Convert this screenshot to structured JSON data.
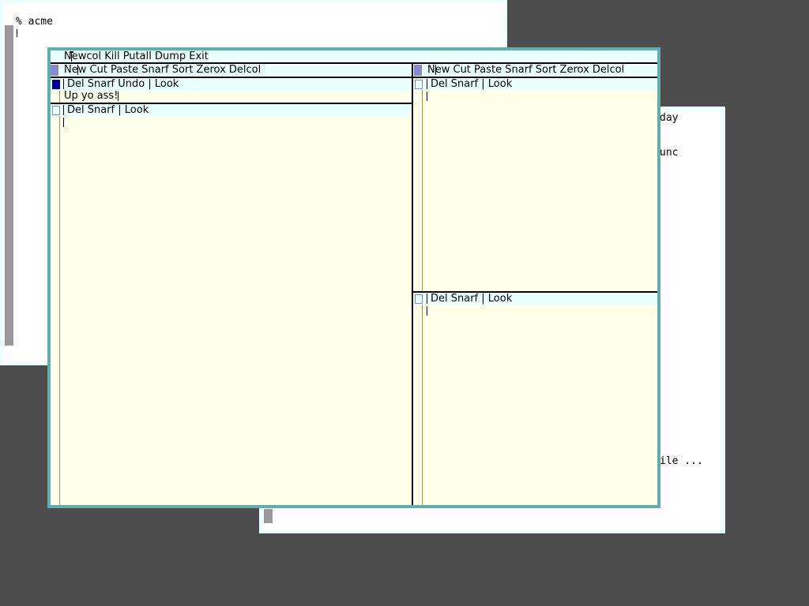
{
  "desktop": {
    "background": "#4d4d4d"
  },
  "rio_window_1": {
    "prompt_line": "% acme"
  },
  "rio_window_2": {
    "visible_fragments": [
      "day",
      "unc",
      "ile ..."
    ]
  },
  "acme": {
    "main_tag": "Newcol Kill Putall Dump Exit",
    "columns": [
      {
        "tag": "New Cut Paste Snarf Sort Zerox Delcol",
        "windows": [
          {
            "tag": "Del Snarf Undo | Look",
            "body": "Up yo ass!",
            "dirty": true
          },
          {
            "tag": "Del Snarf | Look",
            "body": "",
            "dirty": false
          }
        ]
      },
      {
        "tag": "New Cut Paste Snarf Sort Zerox Delcol",
        "windows": [
          {
            "tag": "Del Snarf | Look",
            "body": "",
            "dirty": false
          },
          {
            "tag": "Del Snarf | Look",
            "body": "",
            "dirty": false
          }
        ]
      }
    ],
    "colors": {
      "body": "#ffffea",
      "tag": "#eaffff",
      "border": "#60afaf",
      "dirty_box": "#000099"
    }
  }
}
